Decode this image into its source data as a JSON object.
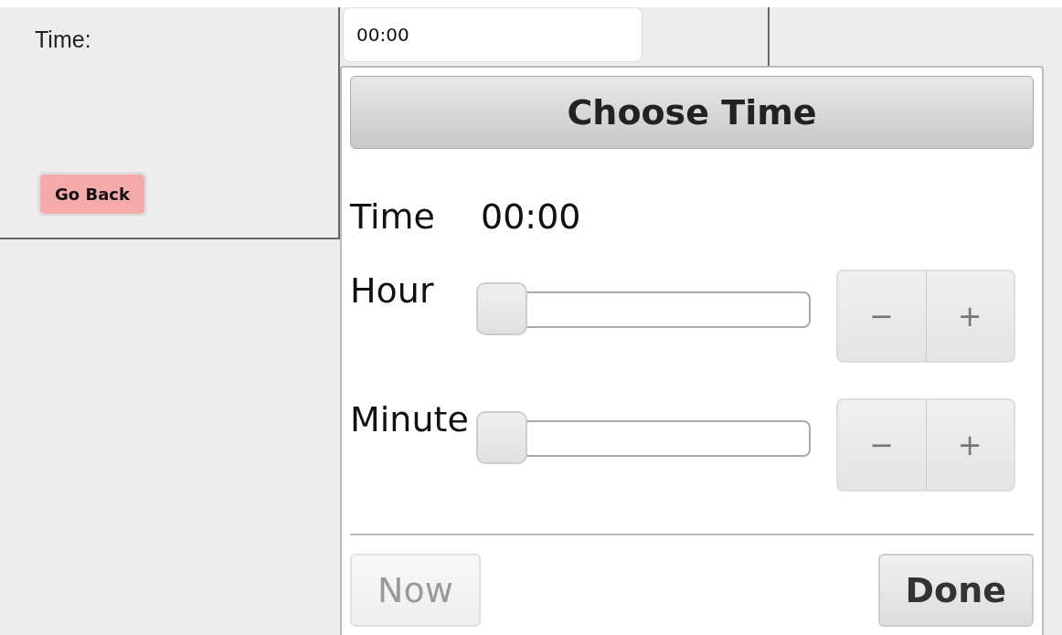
{
  "form": {
    "label": "Time:",
    "value": "00:00"
  },
  "go_back": {
    "label": "Go Back"
  },
  "picker": {
    "title": "Choose Time",
    "readout_label": "Time",
    "readout_value": "00:00",
    "sliders": [
      {
        "label": "Hour",
        "level": 0,
        "minus": "−",
        "plus": "+"
      },
      {
        "label": "Minute",
        "level": 0,
        "minus": "−",
        "plus": "+"
      }
    ],
    "buttons": [
      {
        "label": "Now",
        "disabled": true
      },
      {
        "label": "Done",
        "disabled": false
      }
    ]
  }
}
